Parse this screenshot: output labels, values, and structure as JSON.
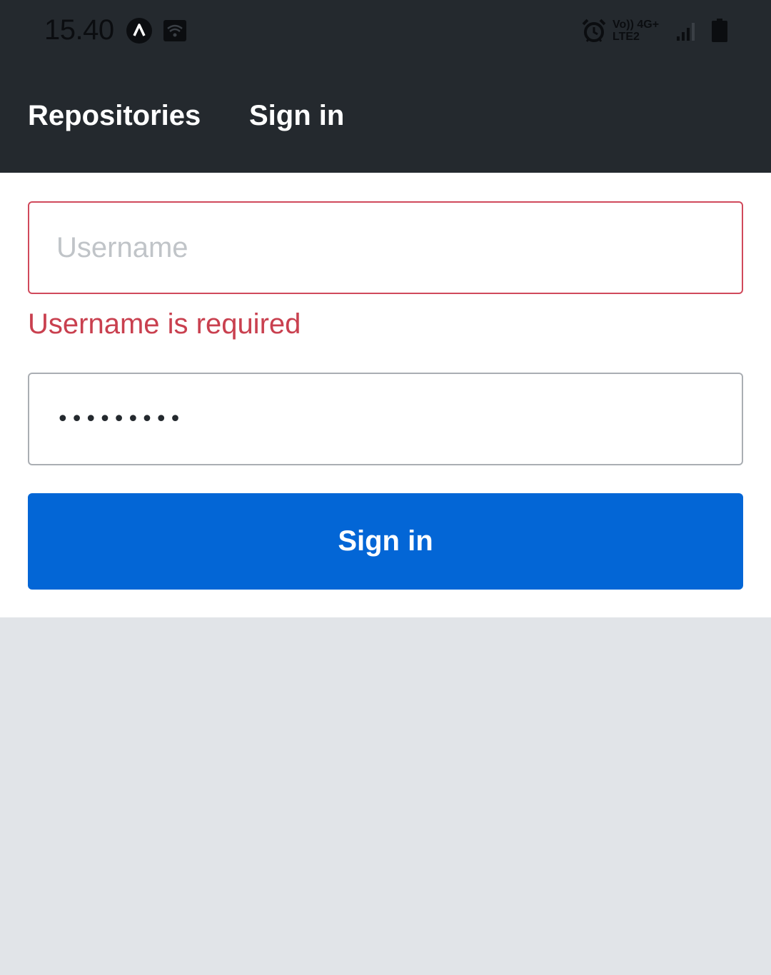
{
  "status_bar": {
    "time": "15.40",
    "network_top": "Vo)) 4G+",
    "network_bottom": "LTE2",
    "icons": [
      "app-notification-icon",
      "wifi-hotspot-icon",
      "alarm-icon",
      "signal-icon",
      "battery-icon"
    ]
  },
  "nav": {
    "tabs": [
      {
        "label": "Repositories"
      },
      {
        "label": "Sign in"
      }
    ]
  },
  "form": {
    "username": {
      "value": "",
      "placeholder": "Username",
      "error": "Username is required"
    },
    "password": {
      "masked_display": "•••••••••"
    },
    "submit_label": "Sign in"
  },
  "colors": {
    "header_bg": "#24292e",
    "accent": "#0366d6",
    "error": "#c9404f",
    "page_bg": "#e1e4e8"
  }
}
